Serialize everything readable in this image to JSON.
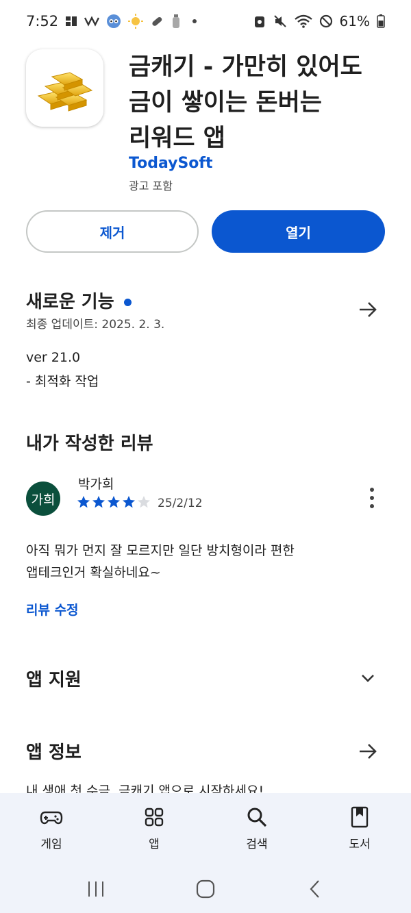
{
  "status_bar": {
    "time": "7:52",
    "battery": "61%"
  },
  "app": {
    "title_lines": [
      "금캐기 - 가만히 있어도",
      "금이 쌓이는 돈버는",
      "리워드 앱"
    ],
    "developer": "TodaySoft",
    "ads_label": "광고 포함",
    "icon": "gold-bars-icon"
  },
  "buttons": {
    "remove": "제거",
    "open": "열기"
  },
  "whats_new": {
    "title": "새로운 기능",
    "updated": "최종 업데이트: 2025. 2. 3.",
    "version": "ver 21.0",
    "note": "- 최적화 작업"
  },
  "my_review": {
    "title": "내가 작성한 리뷰",
    "avatar_text": "가희",
    "reviewer": "박가희",
    "rating": 4,
    "max_rating": 5,
    "date": "25/2/12",
    "text_lines": [
      "아직 뭐가 먼지 잘 모르지만 일단 방치형이라 편한",
      "앱테크인거 확실하네요~"
    ],
    "edit_label": "리뷰 수정"
  },
  "app_support": {
    "title": "앱 지원"
  },
  "app_info": {
    "title": "앱 정보",
    "peek": "내 생애 첫 수금, 금캐기 앱으로 시작하세요!"
  },
  "bottom_nav": {
    "items": [
      {
        "label": "게임",
        "icon": "gamepad-icon"
      },
      {
        "label": "앱",
        "icon": "apps-grid-icon"
      },
      {
        "label": "검색",
        "icon": "search-icon"
      },
      {
        "label": "도서",
        "icon": "book-icon"
      }
    ]
  },
  "colors": {
    "accent": "#0b57d0",
    "avatar": "#0b4f3c",
    "nav_bg": "#f0f3fa"
  }
}
